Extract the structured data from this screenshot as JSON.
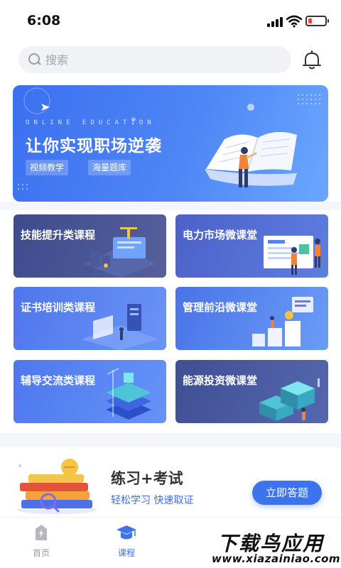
{
  "status_bar": {
    "time": "6:08"
  },
  "search": {
    "placeholder": "搜索"
  },
  "banner": {
    "eyebrow": "ONLINE EDUCATION",
    "title": "让你实现职场逆袭",
    "tags": [
      "视频教学",
      "海量题库"
    ]
  },
  "courses": [
    {
      "label": "技能提升类课程"
    },
    {
      "label": "电力市场微课堂"
    },
    {
      "label": "证书培训类课程"
    },
    {
      "label": "管理前沿微课堂"
    },
    {
      "label": "辅导交流类课程"
    },
    {
      "label": "能源投资微课堂"
    }
  ],
  "promo": {
    "title": "练习+考试",
    "subtitle": "轻松学习  快速取证",
    "button_label": "立即答题"
  },
  "tabbar": {
    "items": [
      {
        "label": "首页",
        "icon": "home-icon",
        "active": false
      },
      {
        "label": "课程",
        "icon": "graduation-cap-icon",
        "active": true
      }
    ]
  },
  "watermark": {
    "line1": "下载鸟应用",
    "line2": "www.xiazainiao.com"
  },
  "colors": {
    "accent": "#3d74ee",
    "inactive_tab": "#999999",
    "card_dark": "#3f4a8c",
    "card_light": "#5b8ef6"
  }
}
